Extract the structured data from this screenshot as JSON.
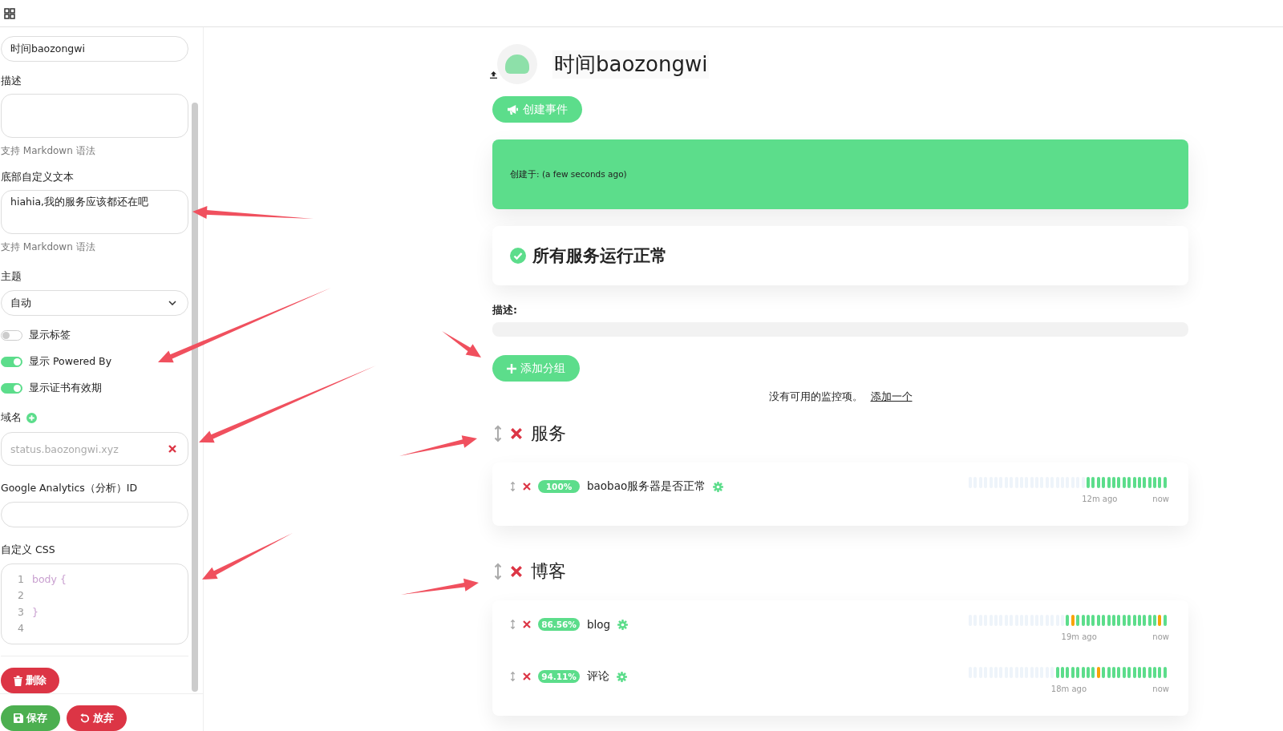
{
  "sidebar": {
    "title_field": {
      "value": "时间baozongwi"
    },
    "description": {
      "label": "描述",
      "hint": "支持 Markdown 语法"
    },
    "footer_text": {
      "label": "底部自定义文本",
      "value": "hiahia,我的服务应该都还在吧",
      "hint": "支持 Markdown 语法"
    },
    "theme": {
      "label": "主题",
      "value": "自动"
    },
    "toggles": [
      {
        "label": "显示标签",
        "on": false
      },
      {
        "label": "显示 Powered By",
        "on": true
      },
      {
        "label": "显示证书有效期",
        "on": true
      }
    ],
    "domains": {
      "label": "域名",
      "items": [
        "status.baozongwi.xyz"
      ]
    },
    "google_analytics": {
      "label": "Google Analytics（分析）ID"
    },
    "custom_css": {
      "label": "自定义 CSS",
      "lines": [
        {
          "number": "1",
          "code": "body {"
        },
        {
          "number": "2"
        },
        {
          "number": "3",
          "code": "}"
        },
        {
          "number": "4"
        }
      ]
    },
    "delete_button": "删除",
    "save_button": "保存",
    "discard_button": "放弃"
  },
  "main": {
    "title": "时间baozongwi",
    "create_incident_button": "创建事件",
    "incident": {
      "meta": "创建于: (a few seconds ago)"
    },
    "overall_status": "所有服务运行正常",
    "description_label": "描述:",
    "add_group_button": "添加分组",
    "empty_message": "没有可用的监控项。",
    "add_link": "添加一个",
    "groups": [
      {
        "name": "服务",
        "monitors": [
          {
            "uptime": "100%",
            "name": "baobao服务器是否正常",
            "since": "12m ago",
            "now": "now",
            "beats": [
              {
                "color": "#eef4fa"
              },
              {
                "color": "#eef4fa"
              },
              {
                "color": "#eef4fa"
              },
              {
                "color": "#eef4fa"
              },
              {
                "color": "#eef4fa"
              },
              {
                "color": "#eef4fa"
              },
              {
                "color": "#eef4fa"
              },
              {
                "color": "#eef4fa"
              },
              {
                "color": "#eef4fa"
              },
              {
                "color": "#eef4fa"
              },
              {
                "color": "#eef4fa"
              },
              {
                "color": "#eef4fa"
              },
              {
                "color": "#eef4fa"
              },
              {
                "color": "#eef4fa"
              },
              {
                "color": "#eef4fa"
              },
              {
                "color": "#eef4fa"
              },
              {
                "color": "#eef4fa"
              },
              {
                "color": "#eef4fa"
              },
              {
                "color": "#eef4fa"
              },
              {
                "color": "#eef4fa"
              },
              {
                "color": "#eef4fa"
              },
              {
                "color": "#eef4fa"
              },
              {
                "color": "#eef4fa"
              },
              {
                "color": "#5cdd8b"
              },
              {
                "color": "#5cdd8b"
              },
              {
                "color": "#5cdd8b"
              },
              {
                "color": "#5cdd8b"
              },
              {
                "color": "#5cdd8b"
              },
              {
                "color": "#5cdd8b"
              },
              {
                "color": "#5cdd8b"
              },
              {
                "color": "#5cdd8b"
              },
              {
                "color": "#5cdd8b"
              },
              {
                "color": "#5cdd8b"
              },
              {
                "color": "#5cdd8b"
              },
              {
                "color": "#5cdd8b"
              },
              {
                "color": "#5cdd8b"
              },
              {
                "color": "#5cdd8b"
              },
              {
                "color": "#5cdd8b"
              },
              {
                "color": "#5cdd8b"
              }
            ]
          }
        ]
      },
      {
        "name": "博客",
        "monitors": [
          {
            "uptime": "86.56%",
            "name": "blog",
            "since": "19m ago",
            "now": "now",
            "beats": [
              {
                "color": "#eef4fa"
              },
              {
                "color": "#eef4fa"
              },
              {
                "color": "#eef4fa"
              },
              {
                "color": "#eef4fa"
              },
              {
                "color": "#eef4fa"
              },
              {
                "color": "#eef4fa"
              },
              {
                "color": "#eef4fa"
              },
              {
                "color": "#eef4fa"
              },
              {
                "color": "#eef4fa"
              },
              {
                "color": "#eef4fa"
              },
              {
                "color": "#eef4fa"
              },
              {
                "color": "#eef4fa"
              },
              {
                "color": "#eef4fa"
              },
              {
                "color": "#eef4fa"
              },
              {
                "color": "#eef4fa"
              },
              {
                "color": "#eef4fa"
              },
              {
                "color": "#eef4fa"
              },
              {
                "color": "#eef4fa"
              },
              {
                "color": "#eef4fa"
              },
              {
                "color": "#5cdd8b"
              },
              {
                "color": "#f8a306"
              },
              {
                "color": "#5cdd8b"
              },
              {
                "color": "#5cdd8b"
              },
              {
                "color": "#5cdd8b"
              },
              {
                "color": "#5cdd8b"
              },
              {
                "color": "#5cdd8b"
              },
              {
                "color": "#5cdd8b"
              },
              {
                "color": "#5cdd8b"
              },
              {
                "color": "#5cdd8b"
              },
              {
                "color": "#5cdd8b"
              },
              {
                "color": "#5cdd8b"
              },
              {
                "color": "#5cdd8b"
              },
              {
                "color": "#5cdd8b"
              },
              {
                "color": "#5cdd8b"
              },
              {
                "color": "#5cdd8b"
              },
              {
                "color": "#5cdd8b"
              },
              {
                "color": "#5cdd8b"
              },
              {
                "color": "#f8a306"
              },
              {
                "color": "#5cdd8b"
              }
            ]
          },
          {
            "uptime": "94.11%",
            "name": "评论",
            "since": "18m ago",
            "now": "now",
            "beats": [
              {
                "color": "#eef4fa"
              },
              {
                "color": "#eef4fa"
              },
              {
                "color": "#eef4fa"
              },
              {
                "color": "#eef4fa"
              },
              {
                "color": "#eef4fa"
              },
              {
                "color": "#eef4fa"
              },
              {
                "color": "#eef4fa"
              },
              {
                "color": "#eef4fa"
              },
              {
                "color": "#eef4fa"
              },
              {
                "color": "#eef4fa"
              },
              {
                "color": "#eef4fa"
              },
              {
                "color": "#eef4fa"
              },
              {
                "color": "#eef4fa"
              },
              {
                "color": "#eef4fa"
              },
              {
                "color": "#eef4fa"
              },
              {
                "color": "#eef4fa"
              },
              {
                "color": "#eef4fa"
              },
              {
                "color": "#5cdd8b"
              },
              {
                "color": "#5cdd8b"
              },
              {
                "color": "#5cdd8b"
              },
              {
                "color": "#5cdd8b"
              },
              {
                "color": "#5cdd8b"
              },
              {
                "color": "#5cdd8b"
              },
              {
                "color": "#5cdd8b"
              },
              {
                "color": "#5cdd8b"
              },
              {
                "color": "#f8a306"
              },
              {
                "color": "#5cdd8b"
              },
              {
                "color": "#5cdd8b"
              },
              {
                "color": "#5cdd8b"
              },
              {
                "color": "#5cdd8b"
              },
              {
                "color": "#5cdd8b"
              },
              {
                "color": "#5cdd8b"
              },
              {
                "color": "#5cdd8b"
              },
              {
                "color": "#5cdd8b"
              },
              {
                "color": "#5cdd8b"
              },
              {
                "color": "#5cdd8b"
              },
              {
                "color": "#5cdd8b"
              },
              {
                "color": "#5cdd8b"
              },
              {
                "color": "#5cdd8b"
              }
            ]
          }
        ]
      }
    ]
  }
}
